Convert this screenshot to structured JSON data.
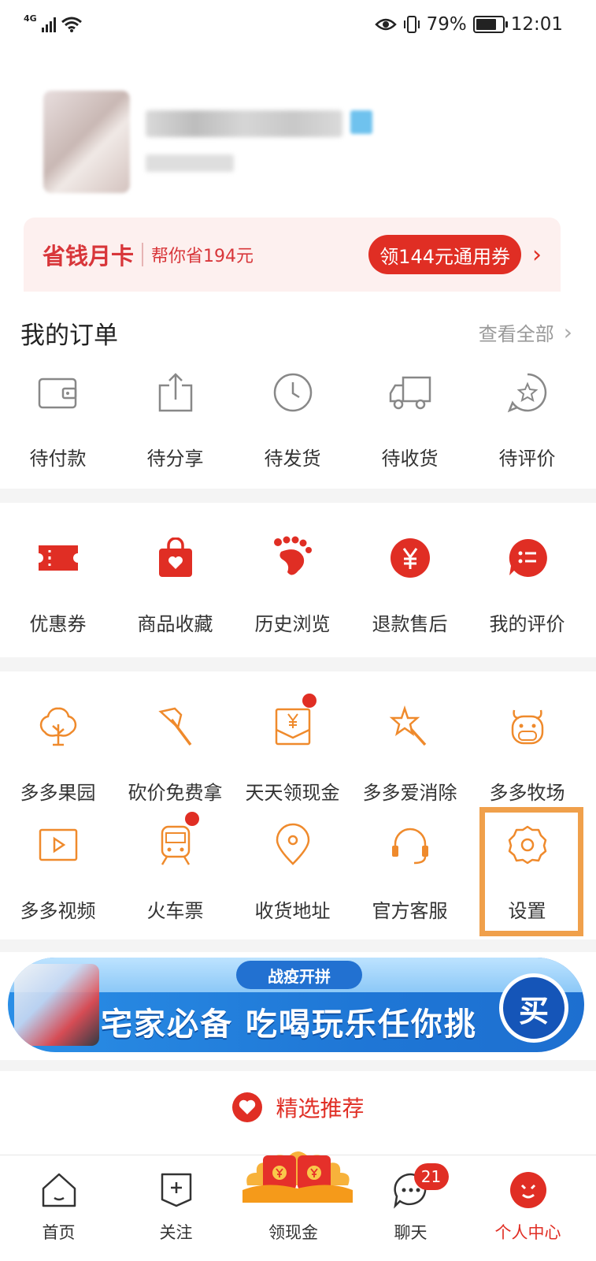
{
  "status_bar": {
    "network": "4G",
    "battery_text": "79%",
    "battery_level": 0.79,
    "time": "12:01"
  },
  "month_card": {
    "title": "省钱月卡",
    "subtitle": "帮你省194元",
    "button": "领144元通用券"
  },
  "orders": {
    "title": "我的订单",
    "view_all": "查看全部",
    "items": [
      {
        "label": "待付款",
        "icon": "wallet-icon"
      },
      {
        "label": "待分享",
        "icon": "share-icon"
      },
      {
        "label": "待发货",
        "icon": "clock-icon"
      },
      {
        "label": "待收货",
        "icon": "truck-icon"
      },
      {
        "label": "待评价",
        "icon": "star-bubble-icon"
      }
    ]
  },
  "shortcuts": {
    "items": [
      {
        "label": "优惠券",
        "icon": "coupon-icon"
      },
      {
        "label": "商品收藏",
        "icon": "favorite-bag-icon"
      },
      {
        "label": "历史浏览",
        "icon": "footprint-icon"
      },
      {
        "label": "退款售后",
        "icon": "refund-yen-icon"
      },
      {
        "label": "我的评价",
        "icon": "review-bubble-icon"
      }
    ]
  },
  "services": {
    "row1": [
      {
        "label": "多多果园",
        "icon": "tree-icon"
      },
      {
        "label": "砍价免费拿",
        "icon": "axe-icon"
      },
      {
        "label": "天天领现金",
        "icon": "cash-envelope-icon",
        "dot": true
      },
      {
        "label": "多多爱消除",
        "icon": "magic-wand-icon"
      },
      {
        "label": "多多牧场",
        "icon": "cow-icon"
      }
    ],
    "row2": [
      {
        "label": "多多视频",
        "icon": "video-icon"
      },
      {
        "label": "火车票",
        "icon": "train-icon",
        "dot": true
      },
      {
        "label": "收货地址",
        "icon": "location-pin-icon"
      },
      {
        "label": "官方客服",
        "icon": "headset-icon"
      },
      {
        "label": "设置",
        "icon": "settings-gear-icon"
      }
    ]
  },
  "banner": {
    "top_label": "战疫开拼",
    "main_text": "宅家必备 吃喝玩乐任你挑",
    "buy_label": "买"
  },
  "recommend": {
    "title": "精选推荐"
  },
  "tab_bar": {
    "tabs": [
      {
        "label": "首页",
        "icon": "home-icon"
      },
      {
        "label": "关注",
        "icon": "follow-plus-icon"
      },
      {
        "label": "领现金",
        "icon": "red-envelope-icon"
      },
      {
        "label": "聊天",
        "icon": "chat-icon",
        "badge": "21"
      },
      {
        "label": "个人中心",
        "icon": "profile-icon"
      }
    ]
  },
  "colors": {
    "brand_red": "#e02e24",
    "orange": "#ef8a2c",
    "highlight": "#f0a04b",
    "gray_icon": "#888888"
  }
}
